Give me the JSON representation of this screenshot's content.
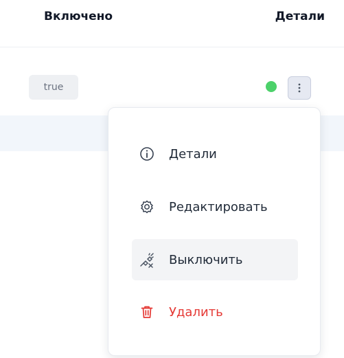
{
  "table": {
    "columns": {
      "enabled": "Включено",
      "details": "Детали"
    },
    "row": {
      "enabled_value": "true",
      "status_color": "#4cd16a"
    }
  },
  "menu": {
    "items": [
      {
        "label": "Детали",
        "icon": "info-icon"
      },
      {
        "label": "Редактировать",
        "icon": "gear-icon"
      },
      {
        "label": "Выключить",
        "icon": "unplug-icon",
        "hovered": true
      },
      {
        "label": "Удалить",
        "icon": "trash-icon",
        "color": "#e53935"
      }
    ]
  }
}
